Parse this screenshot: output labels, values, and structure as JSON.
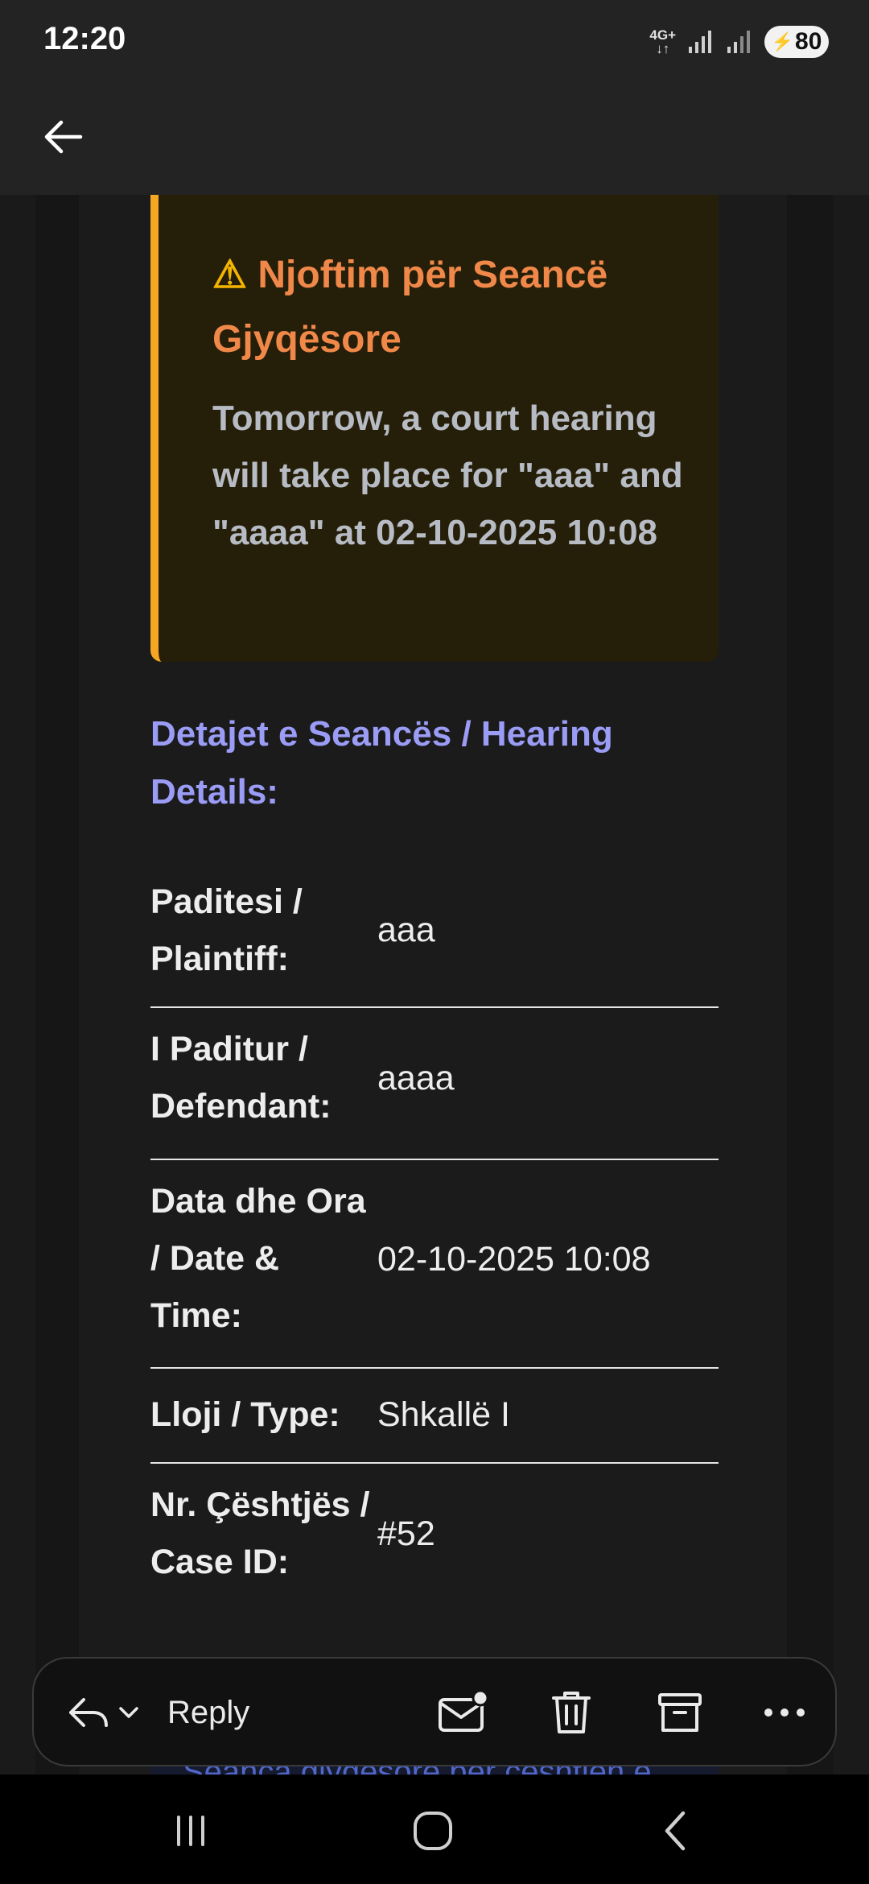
{
  "status_bar": {
    "time": "12:20",
    "network": "4G+",
    "battery": "80"
  },
  "alert": {
    "icon": "warning-icon",
    "title": "Njoftim për Seancë Gjyqësore",
    "text": "Tomorrow, a court hearing will take place for \"aaa\" and \"aaaa\" at 02-10-2025 10:08",
    "accent_color": "#f5a623",
    "title_color": "#f0884a"
  },
  "details": {
    "heading": "Detajet e Seancës / Hearing Details:",
    "rows": [
      {
        "label": "Paditesi / Plaintiff:",
        "value": "aaa"
      },
      {
        "label": "I Paditur / Defendant:",
        "value": "aaaa"
      },
      {
        "label": "Data dhe Ora / Date & Time:",
        "value": "02-10-2025 10:08"
      },
      {
        "label": "Lloji / Type:",
        "value": "Shkallë I"
      },
      {
        "label": "Nr. Çështjës / Case ID:",
        "value": "#52"
      }
    ]
  },
  "partial_text": "Seanca gjyqësore për çështjen e",
  "action_bar": {
    "reply_label": "Reply",
    "icons": [
      "reply-icon",
      "chevron-down-icon",
      "mark-unread-icon",
      "delete-icon",
      "archive-icon",
      "more-icon"
    ]
  },
  "nav_bar": {
    "icons": [
      "recent-apps-icon",
      "home-icon",
      "nav-back-icon"
    ]
  }
}
